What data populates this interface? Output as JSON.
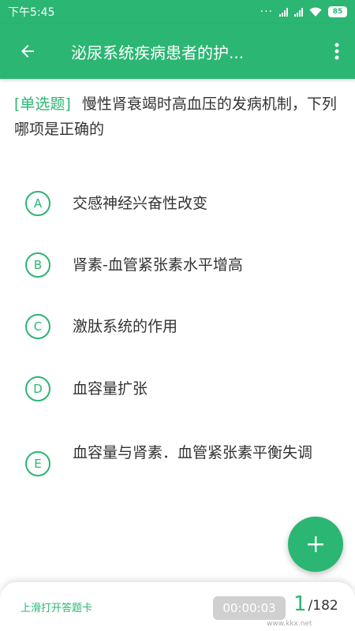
{
  "status_bar": {
    "time": "下午5:45",
    "battery": "85"
  },
  "app_bar": {
    "title": "泌尿系统疾病患者的护..."
  },
  "question": {
    "type_label": "[单选题]",
    "text": "慢性肾衰竭时高血压的发病机制，下列哪项是正确的"
  },
  "options": [
    {
      "letter": "A",
      "text": "交感神经兴奋性改变"
    },
    {
      "letter": "B",
      "text": "肾素-血管紧张素水平增高"
    },
    {
      "letter": "C",
      "text": "激肽系统的作用"
    },
    {
      "letter": "D",
      "text": "血容量扩张"
    },
    {
      "letter": "E",
      "text": "血容量与肾素．血管紧张素平衡失调"
    }
  ],
  "bottom_bar": {
    "swipe_hint": "上滑打开答题卡",
    "timer": "00:00:03",
    "current": "1",
    "total": "/182"
  },
  "watermark": "www.kkx.net"
}
